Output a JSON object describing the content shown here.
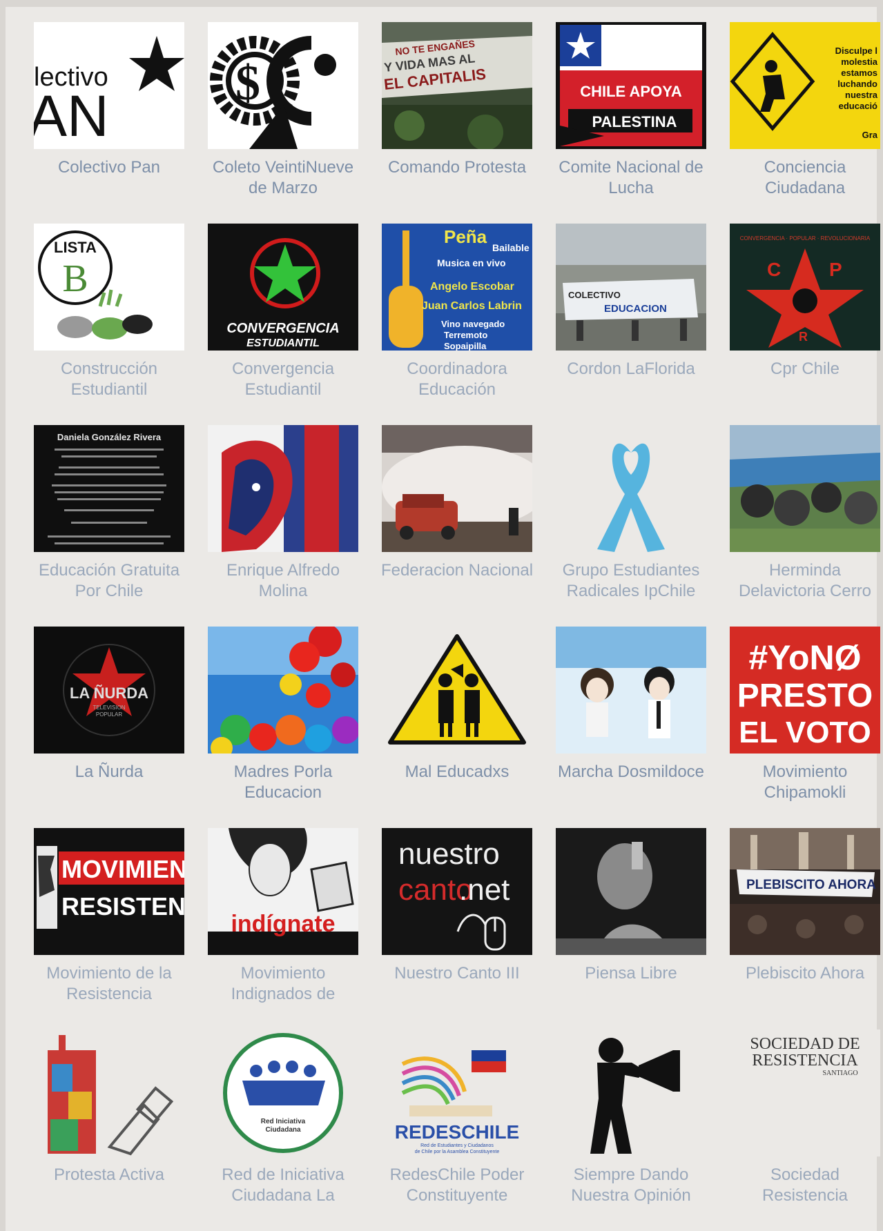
{
  "pages": [
    {
      "name": "Colectivo Pan",
      "logo_text": [
        "lectivo",
        "AN"
      ]
    },
    {
      "name": "Coleto VeintiNueve de Marzo",
      "logo_text": [
        "$"
      ]
    },
    {
      "name": "Comando Protesta",
      "logo_text": [
        "NO TE ENGAÑES",
        "Y VIDA MAS AL",
        "EL CAPITALIS"
      ]
    },
    {
      "name": "Comite Nacional de Lucha",
      "logo_text": [
        "CHILE APOYA",
        "PALESTINA"
      ]
    },
    {
      "name": "Conciencia Ciudadana",
      "logo_text": [
        "Disculpe l",
        "molestia",
        "estamos",
        "luchando",
        "nuestra",
        "educació",
        "Gra"
      ]
    },
    {
      "name": "Construcción Estudiantil",
      "logo_text": [
        "LISTA",
        "B"
      ]
    },
    {
      "name": "Convergencia Estudiantil",
      "logo_text": [
        "CONVERGENCIA",
        "ESTUDIANTIL"
      ]
    },
    {
      "name": "Coordinadora Educación",
      "logo_text": [
        "Peña",
        "Bailable",
        "Musica en vivo",
        "Angelo Escobar",
        "Juan Carlos Labrin",
        "Vino navegado",
        "Terremoto",
        "Sopaipilla"
      ]
    },
    {
      "name": "Cordon LaFlorida",
      "logo_text": [
        "COLECTIVO",
        "EDUCACION"
      ]
    },
    {
      "name": "Cpr Chile",
      "logo_text": [
        "CONVERGENCIA · POPULAR · REVOLUCIONARIA",
        "C",
        "P",
        "R"
      ]
    },
    {
      "name": "Educación Gratuita Por Chile",
      "logo_text": [
        "Daniela González Rivera"
      ]
    },
    {
      "name": "Enrique Alfredo Molina",
      "logo_text": []
    },
    {
      "name": "Federacion Nacional",
      "logo_text": []
    },
    {
      "name": "Grupo Estudiantes Radicales IpChile",
      "logo_text": []
    },
    {
      "name": "Herminda Delavictoria Cerro",
      "logo_text": []
    },
    {
      "name": "La Ñurda",
      "logo_text": [
        "LA ÑURDA",
        "TELEVISION",
        "POPULAR"
      ]
    },
    {
      "name": "Madres Porla Educacion",
      "logo_text": []
    },
    {
      "name": "Mal Educadxs",
      "logo_text": []
    },
    {
      "name": "Marcha Dosmildoce",
      "logo_text": []
    },
    {
      "name": "Movimiento Chipamokli",
      "logo_text": [
        "#YoNØ",
        "PRESTO",
        "EL VOTO"
      ]
    },
    {
      "name": "Movimiento de la Resistencia",
      "logo_text": [
        "MOVIMIENTO",
        "RESISTENCIA"
      ]
    },
    {
      "name": "Movimiento Indignados de",
      "logo_text": [
        "indígnate"
      ]
    },
    {
      "name": "Nuestro Canto III",
      "logo_text": [
        "nuestro",
        "canto",
        ".net"
      ]
    },
    {
      "name": "Piensa Libre",
      "logo_text": []
    },
    {
      "name": "Plebiscito Ahora",
      "logo_text": [
        "PLEBISCITO AHORA"
      ]
    },
    {
      "name": "Protesta Activa",
      "logo_text": []
    },
    {
      "name": "Red de Iniciativa Ciudadana La",
      "logo_text": [
        "Red Iniciativa",
        "Ciudadana"
      ]
    },
    {
      "name": "RedesChile Poder Constituyente",
      "logo_text": [
        "REDESCHILE",
        "Red de Estudiantes y Ciudadanos",
        "de Chile por la Asamblea Constituyente"
      ]
    },
    {
      "name": "Siempre Dando Nuestra Opinión",
      "logo_text": []
    },
    {
      "name": "Sociedad Resistencia",
      "logo_text": [
        "SOCIEDAD DE",
        "RESISTENCIA",
        "SANTIAGO"
      ]
    }
  ]
}
